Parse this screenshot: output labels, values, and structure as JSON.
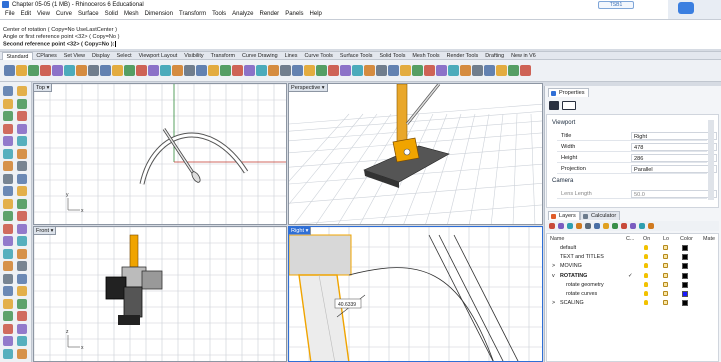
{
  "window": {
    "title": "Chapter 05-05 (1 MB) - Rhinoceros 6 Educational",
    "badge": "TSB1"
  },
  "menu": [
    "File",
    "Edit",
    "View",
    "Curve",
    "Surface",
    "Solid",
    "Mesh",
    "Dimension",
    "Transform",
    "Tools",
    "Analyze",
    "Render",
    "Panels",
    "Help"
  ],
  "command_history": [
    "Center of rotation ( Copy=No  UseLastCenter )",
    "Angle or first reference point <32> ( Copy=No )",
    "Second reference point <32> ( Copy=No ):"
  ],
  "toolbar_tabs": [
    "Standard",
    "CPlanes",
    "Set View",
    "Display",
    "Select",
    "Viewport Layout",
    "Visibility",
    "Transform",
    "Curve Drawing",
    "Lines",
    "Curve Tools",
    "Surface Tools",
    "Solid Tools",
    "Mesh Tools",
    "Render Tools",
    "Drafting",
    "New in V6"
  ],
  "active_tab": "Standard",
  "viewports": {
    "top": {
      "title": "Top"
    },
    "perspective": {
      "title": "Perspective"
    },
    "front": {
      "title": "Front"
    },
    "right": {
      "title": "Right"
    },
    "dimension_label": "40.6339"
  },
  "axis_labels": {
    "x": "x",
    "y": "y",
    "z": "z"
  },
  "properties": {
    "tab": "Properties",
    "section_viewport": "Viewport",
    "rows": [
      {
        "key": "Title",
        "value": "Right"
      },
      {
        "key": "Width",
        "value": "478"
      },
      {
        "key": "Height",
        "value": "286"
      },
      {
        "key": "Projection",
        "value": "Parallel"
      }
    ],
    "section_camera": "Camera",
    "lens_row": {
      "key": "Lens Length",
      "value": "50.0"
    }
  },
  "layers_panel": {
    "tabs": [
      "Layers",
      "Calculator"
    ],
    "columns": [
      "Name",
      "C...",
      "On",
      "Lo",
      "Color",
      "Mate"
    ],
    "rows": [
      {
        "name": "default",
        "indent": 0,
        "expander": "",
        "color": "#000000",
        "current": false,
        "bold": false
      },
      {
        "name": "TEXT and TITLES",
        "indent": 0,
        "expander": "",
        "color": "#000000",
        "current": false,
        "bold": false
      },
      {
        "name": "MOVING",
        "indent": 0,
        "expander": ">",
        "color": "#000000",
        "current": false,
        "bold": false
      },
      {
        "name": "ROTATING",
        "indent": 0,
        "expander": "v",
        "color": "#000000",
        "current": true,
        "bold": true
      },
      {
        "name": "rotate geometry",
        "indent": 1,
        "expander": "",
        "color": "#000000",
        "current": false,
        "bold": false
      },
      {
        "name": "rotate curves",
        "indent": 1,
        "expander": "",
        "color": "#1a1aff",
        "current": false,
        "bold": false
      },
      {
        "name": "SCALING",
        "indent": 0,
        "expander": ">",
        "color": "#000000",
        "current": false,
        "bold": false
      }
    ],
    "check": "✓"
  },
  "colors": {
    "accent": "#2f6fd6",
    "selection": "#f0a400",
    "x_axis": "#c0392b",
    "y_axis": "#2e8b3a"
  }
}
